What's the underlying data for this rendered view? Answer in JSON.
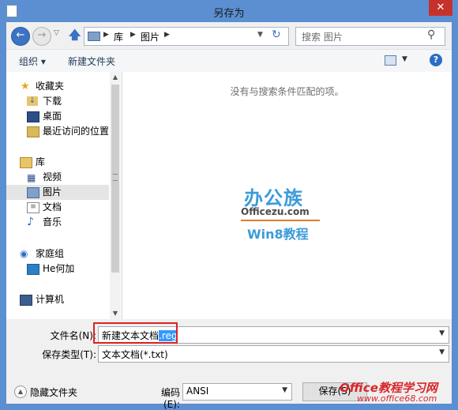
{
  "window": {
    "title": "另存为",
    "close_glyph": "✕"
  },
  "nav": {
    "back_glyph": "←",
    "forward_glyph": "→",
    "dropdown_glyph": "▽",
    "up_glyph": "🡅",
    "address": {
      "segments": [
        "库",
        "图片"
      ],
      "separator": "▶",
      "dropdown_glyph": "▼",
      "refresh_glyph": "↻"
    },
    "search": {
      "placeholder": "搜索 图片",
      "icon": "search-icon",
      "glyph": "⚲"
    }
  },
  "toolbar": {
    "organize_label": "组织 ▾",
    "new_folder_label": "新建文件夹",
    "help_glyph": "?",
    "view_dropdown_glyph": "▼"
  },
  "sidebar": {
    "items": [
      {
        "label": "收藏夹",
        "icon": "star-icon",
        "glyph": "★"
      },
      {
        "label": "下载",
        "icon": "download-folder-icon",
        "glyph": "↓"
      },
      {
        "label": "桌面",
        "icon": "desktop-icon",
        "glyph": ""
      },
      {
        "label": "最近访问的位置",
        "icon": "recent-places-icon",
        "glyph": ""
      },
      {
        "label": "库",
        "icon": "library-icon",
        "glyph": ""
      },
      {
        "label": "视频",
        "icon": "video-icon",
        "glyph": "▦"
      },
      {
        "label": "图片",
        "icon": "pictures-icon",
        "glyph": ""
      },
      {
        "label": "文档",
        "icon": "documents-icon",
        "glyph": "≡"
      },
      {
        "label": "音乐",
        "icon": "music-icon",
        "glyph": "♪"
      },
      {
        "label": "家庭组",
        "icon": "homegroup-icon",
        "glyph": "◉"
      },
      {
        "label": "He何加",
        "icon": "computer-user-icon",
        "glyph": ""
      },
      {
        "label": "计算机",
        "icon": "computer-icon",
        "glyph": ""
      }
    ],
    "scroll_up_glyph": "▲",
    "scroll_down_glyph": "▼"
  },
  "content": {
    "empty_message": "没有与搜索条件匹配的项。",
    "logo": {
      "top": "办公族",
      "middle": "Officezu.com",
      "bottom": "Win8教程"
    }
  },
  "form": {
    "filename_label": "文件名(N):",
    "filename_value_plain": "新建文本文档",
    "filename_value_selected": ".reg",
    "filetype_label": "保存类型(T):",
    "filetype_value": "文本文档(*.txt)",
    "encoding_label": "编码(E):",
    "encoding_value": "ANSI",
    "hide_folders_label": "隐藏文件夹",
    "hide_folders_glyph": "▲",
    "save_label": "保存(S)",
    "dropdown_glyph": "▼"
  },
  "watermark": {
    "text": "Office教程学习网",
    "url": "www.office68.com"
  },
  "colors": {
    "accent": "#3b74c4",
    "highlight": "#3399ff",
    "annotation": "#e02020"
  }
}
